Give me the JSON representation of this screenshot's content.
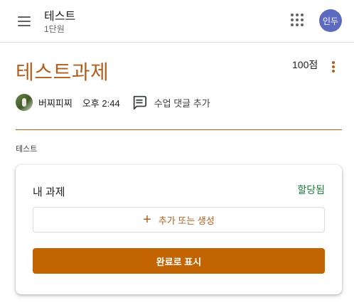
{
  "header": {
    "class_title": "테스트",
    "class_subtitle": "1단원",
    "avatar_initials": "인두",
    "icons": {
      "menu": "hamburger-menu-icon",
      "apps": "apps-grid-icon"
    }
  },
  "assignment": {
    "title": "테스트과제",
    "points": "100점",
    "author": "버찌피찌",
    "posted_time": "오후 2:44",
    "comment_label": "수업 댓글 추가",
    "description": "테스트"
  },
  "work_card": {
    "title": "내 과제",
    "status": "할당됨",
    "add_label": "추가 또는 생성",
    "mark_done_label": "완료로 표시"
  },
  "colors": {
    "accent": "#b25f1e",
    "primary_button": "#c26401",
    "status_green": "#188038",
    "avatar_bg": "#5c6bc0"
  }
}
